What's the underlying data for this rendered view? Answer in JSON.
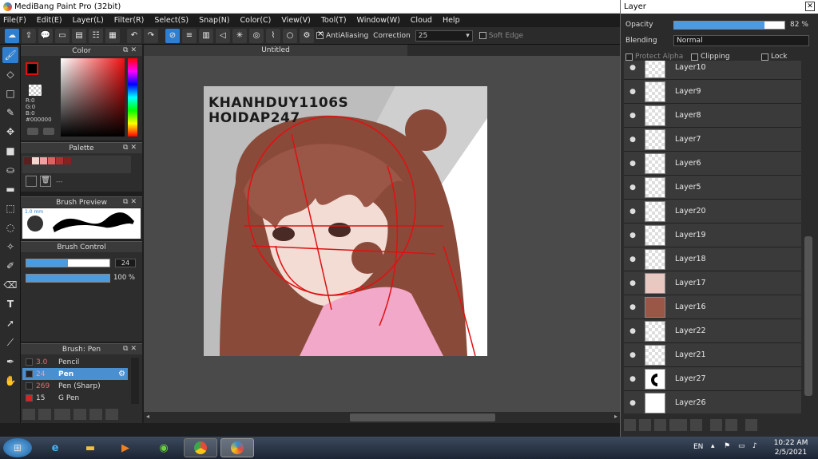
{
  "window_title": "MediBang Paint Pro (32bit)",
  "menu": [
    "File(F)",
    "Edit(E)",
    "Layer(L)",
    "Filter(R)",
    "Select(S)",
    "Snap(N)",
    "Color(C)",
    "View(V)",
    "Tool(T)",
    "Window(W)",
    "Cloud",
    "Help"
  ],
  "toolbar": {
    "antialiasing_label": "AntiAliasing",
    "correction_label": "Correction",
    "correction_value": "25",
    "soft_edge_label": "Soft Edge"
  },
  "color_panel": {
    "title": "Color",
    "r": "R:0",
    "g": "G:0",
    "b": "B:0",
    "hex": "#000000"
  },
  "palette_panel": {
    "title": "Palette",
    "bottom_text": "---"
  },
  "brush_preview": {
    "title": "Brush Preview",
    "size_label": "1.0 mm"
  },
  "brush_control": {
    "title": "Brush Control",
    "size_value": "24",
    "opacity_value": "100 %"
  },
  "brush_list": {
    "title": "Brush: Pen",
    "items": [
      {
        "size": "3.0",
        "name": "Pencil"
      },
      {
        "size": "24",
        "name": "Pen"
      },
      {
        "size": "269",
        "name": "Pen (Sharp)"
      },
      {
        "size": "15",
        "name": "G Pen"
      }
    ]
  },
  "canvas": {
    "tab_title": "Untitled",
    "watermark_line1": "KHANHDUY1106S",
    "watermark_line2": "HOIDAP247"
  },
  "layer_panel": {
    "title": "Layer",
    "opacity_label": "Opacity",
    "opacity_value": "82 %",
    "opacity_fraction": 0.82,
    "blending_label": "Blending",
    "blending_value": "Normal",
    "protect_alpha_label": "Protect Alpha",
    "clipping_label": "Clipping",
    "lock_label": "Lock",
    "layers": [
      "Layer10",
      "Layer9",
      "Layer8",
      "Layer7",
      "Layer6",
      "Layer5",
      "Layer20",
      "Layer19",
      "Layer18",
      "Layer17",
      "Layer16",
      "Layer22",
      "Layer21",
      "Layer27",
      "Layer26"
    ]
  },
  "taskbar": {
    "language": "EN",
    "time": "10:22 AM",
    "date": "2/5/2021"
  },
  "colors": {
    "accent": "#2f7fd0",
    "hair": "#8a4a3a",
    "skin": "#f2dcd4",
    "shirt": "#f2a8c8",
    "sketch_red": "#e01010"
  }
}
